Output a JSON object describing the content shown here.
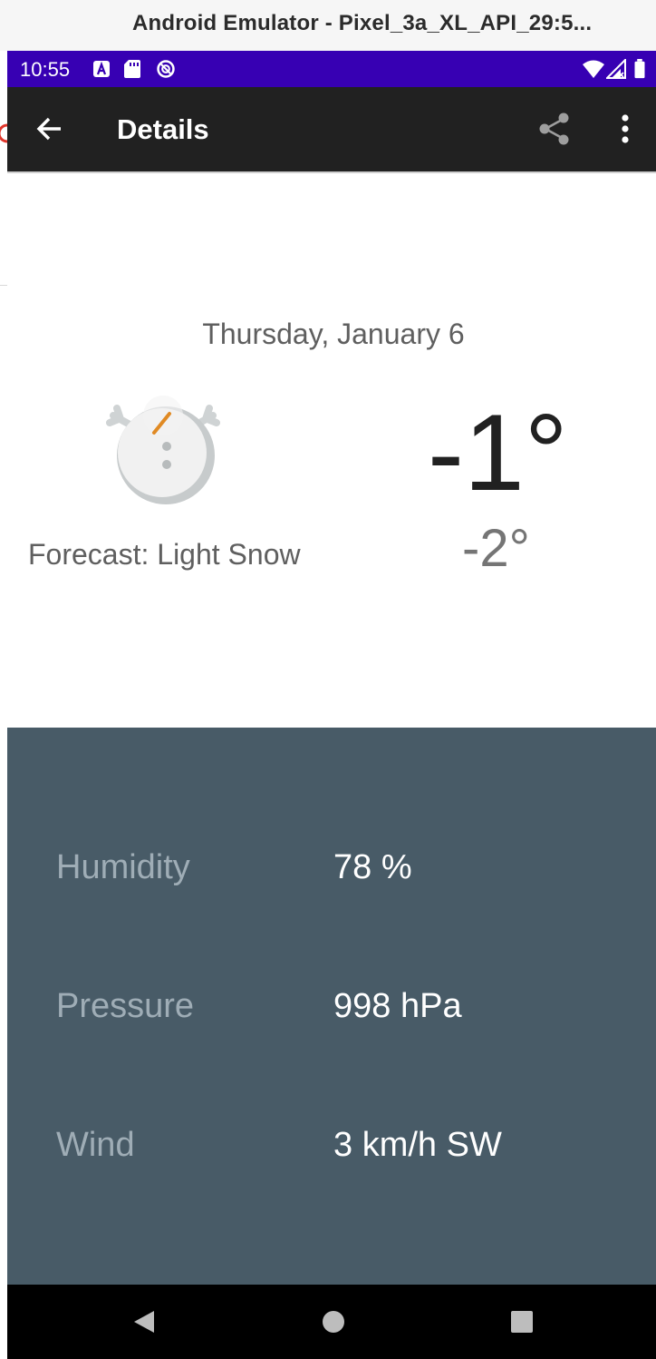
{
  "host_window": {
    "title": "Android Emulator - Pixel_3a_XL_API_29:5..."
  },
  "status_bar": {
    "time": "10:55",
    "icons": [
      "a-notification-icon",
      "sd-card-icon",
      "data-saver-icon",
      "wifi-icon",
      "signal-icon",
      "battery-icon"
    ],
    "background_color": "#3700b3"
  },
  "app_bar": {
    "title": "Details",
    "background_color": "#212121",
    "back_icon": "arrow-back-icon",
    "share_icon": "share-icon",
    "menu_icon": "more-vert-icon"
  },
  "forecast": {
    "date": "Thursday, January 6",
    "description": "Forecast: Light Snow",
    "high": "-1°",
    "low": "-2°",
    "icon": "snowman-icon"
  },
  "details": {
    "background_color": "#485b67",
    "rows": [
      {
        "label": "Humidity",
        "value": "78 %"
      },
      {
        "label": "Pressure",
        "value": "998 hPa"
      },
      {
        "label": "Wind",
        "value": "3 km/h SW"
      }
    ]
  },
  "nav_bar": {
    "buttons": [
      "back-triangle-icon",
      "home-circle-icon",
      "recents-square-icon"
    ]
  }
}
